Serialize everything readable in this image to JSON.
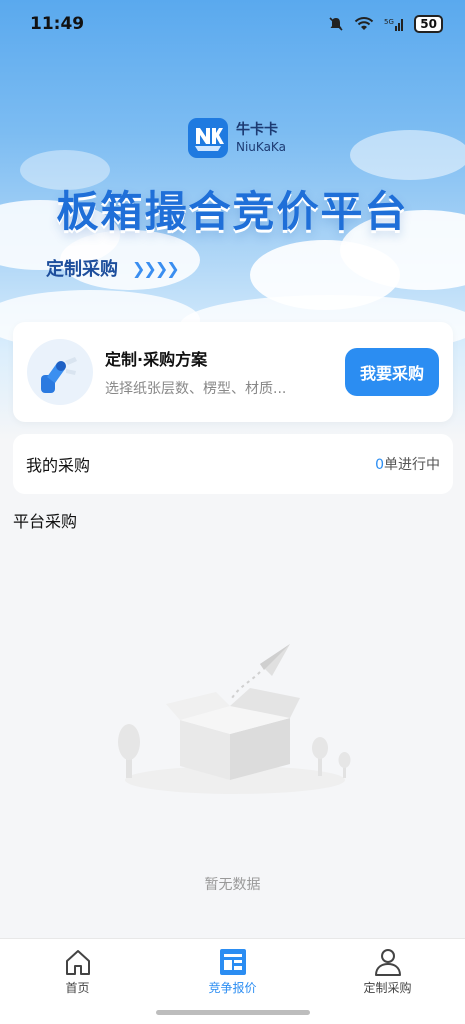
{
  "status": {
    "time": "11:49",
    "battery": "50",
    "network": "5G"
  },
  "brand": {
    "name_cn": "牛卡卡",
    "name_en": "NiuKaKa"
  },
  "hero": {
    "title": "板箱撮合竞价平台",
    "subtitle": "定制采购",
    "chevrons": "❯❯❯❯"
  },
  "custom_card": {
    "title": "定制·采购方案",
    "desc": "选择纸张层数、楞型、材质...",
    "button": "我要采购"
  },
  "my_purchase": {
    "title": "我的采购",
    "count": "0",
    "status": "单进行中"
  },
  "platform": {
    "title": "平台采购",
    "empty": "暂无数据"
  },
  "tabs": [
    {
      "label": "首页",
      "icon": "home-icon",
      "active": false
    },
    {
      "label": "竞争报价",
      "icon": "quote-icon",
      "active": true
    },
    {
      "label": "定制采购",
      "icon": "user-icon",
      "active": false
    }
  ],
  "colors": {
    "accent": "#2b8df2",
    "title_blue": "#1f6fd8"
  }
}
